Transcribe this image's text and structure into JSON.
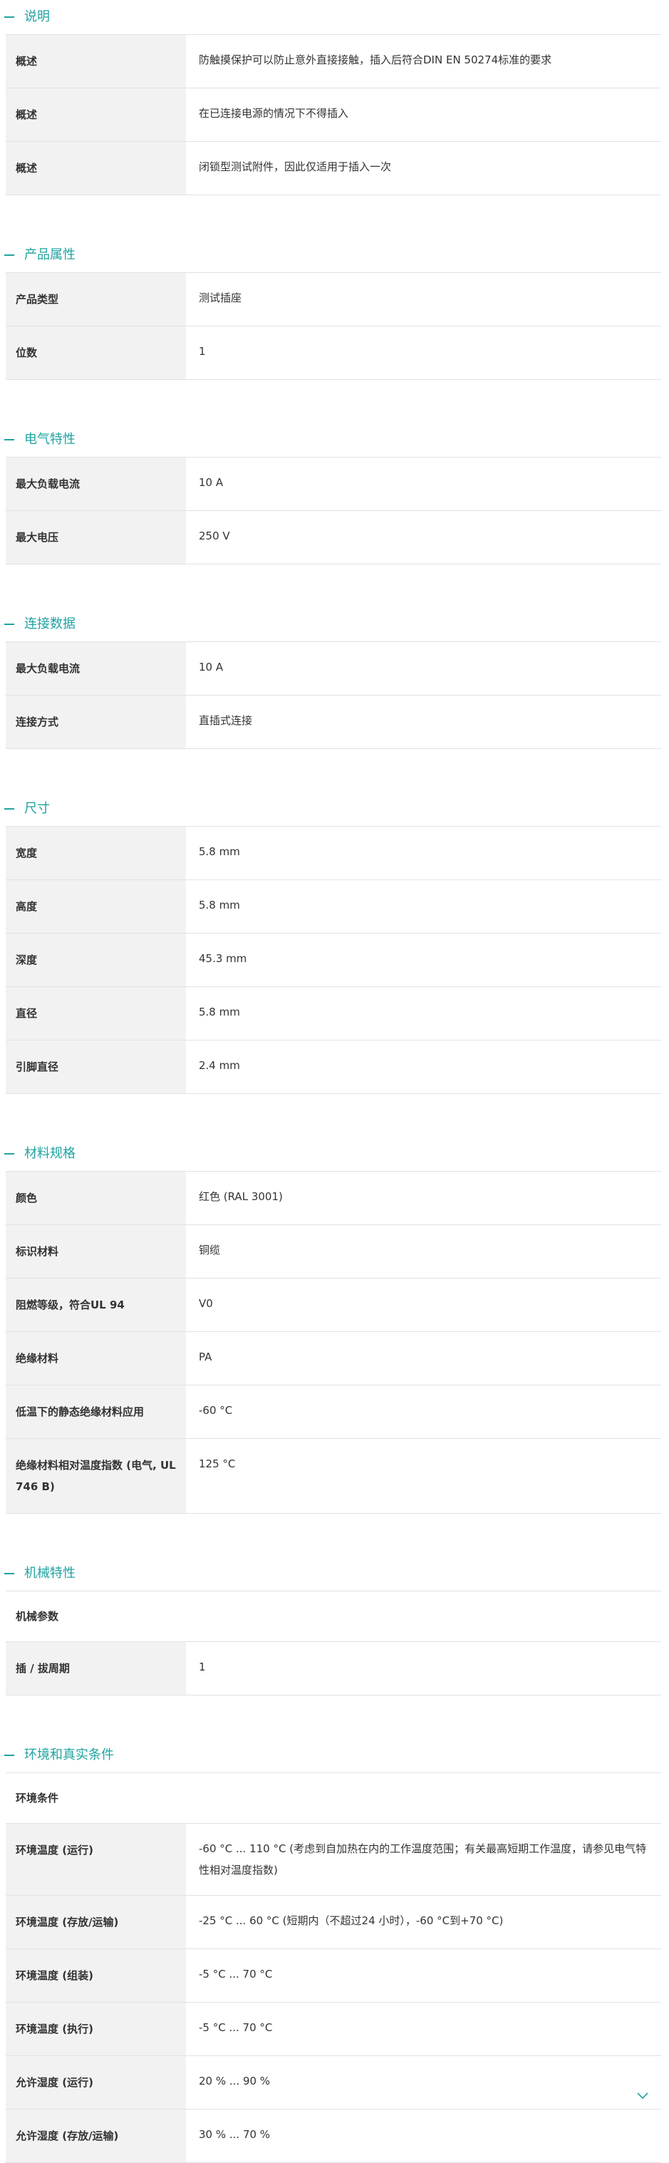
{
  "sections": [
    {
      "id": "description",
      "title": "说明",
      "rows": [
        {
          "label": "概述",
          "value": "防触摸保护可以防止意外直接接触，插入后符合DIN EN 50274标准的要求"
        },
        {
          "label": "概述",
          "value": "在已连接电源的情况下不得插入"
        },
        {
          "label": "概述",
          "value": "闭锁型测试附件，因此仅适用于插入一次"
        }
      ]
    },
    {
      "id": "product-properties",
      "title": "产品属性",
      "rows": [
        {
          "label": "产品类型",
          "value": "测试插座"
        },
        {
          "label": "位数",
          "value": "1"
        }
      ]
    },
    {
      "id": "electrical",
      "title": "电气特性",
      "rows": [
        {
          "label": "最大负载电流",
          "value": "10 A"
        },
        {
          "label": "最大电压",
          "value": "250 V"
        }
      ]
    },
    {
      "id": "connection",
      "title": "连接数据",
      "rows": [
        {
          "label": "最大负载电流",
          "value": "10 A"
        },
        {
          "label": "连接方式",
          "value": "直插式连接"
        }
      ]
    },
    {
      "id": "dimensions",
      "title": "尺寸",
      "rows": [
        {
          "label": "宽度",
          "value": "5.8 mm"
        },
        {
          "label": "高度",
          "value": "5.8 mm"
        },
        {
          "label": "深度",
          "value": "45.3 mm"
        },
        {
          "label": "直径",
          "value": "5.8 mm"
        },
        {
          "label": "引脚直径",
          "value": "2.4 mm"
        }
      ]
    },
    {
      "id": "materials",
      "title": "材料规格",
      "rows": [
        {
          "label": "颜色",
          "value": "红色 (RAL 3001)"
        },
        {
          "label": "标识材料",
          "value": "铜缆"
        },
        {
          "label": "阻燃等级，符合UL 94",
          "value": "V0"
        },
        {
          "label": "绝缘材料",
          "value": "PA"
        },
        {
          "label": "低温下的静态绝缘材料应用",
          "value": "-60 °C"
        },
        {
          "label": "绝缘材料相对温度指数 (电气, UL 746 B)",
          "value": "125 °C"
        }
      ]
    },
    {
      "id": "mechanical",
      "title": "机械特性",
      "group": "机械参数",
      "rows": [
        {
          "label": "插 / 拔周期",
          "value": "1"
        }
      ]
    },
    {
      "id": "environment",
      "title": "环境和真实条件",
      "group": "环境条件",
      "rows": [
        {
          "label": "环境温度 (运行)",
          "value": "-60 °C ... 110 °C (考虑到自加热在内的工作温度范围；有关最高短期工作温度，请参见电气特性相对温度指数)"
        },
        {
          "label": "环境温度 (存放/运输)",
          "value": "-25 °C ... 60 °C (短期内（不超过24 小时），-60 °C到+70 °C)"
        },
        {
          "label": "环境温度 (组装)",
          "value": "-5 °C ... 70 °C"
        },
        {
          "label": "环境温度 (执行)",
          "value": "-5 °C ... 70 °C"
        },
        {
          "label": "允许湿度 (运行)",
          "value": "20 % ... 90 %"
        },
        {
          "label": "允许湿度 (存放/运输)",
          "value": "30 % ... 70 %"
        }
      ]
    }
  ],
  "colors": {
    "accent": "#1fa3a0",
    "label_bg": "#f2f2f2",
    "border": "#e2e2e2",
    "text": "#333333"
  },
  "icons": {
    "section_toggle": "minus-icon",
    "scroll_more": "chevron-down-icon"
  }
}
